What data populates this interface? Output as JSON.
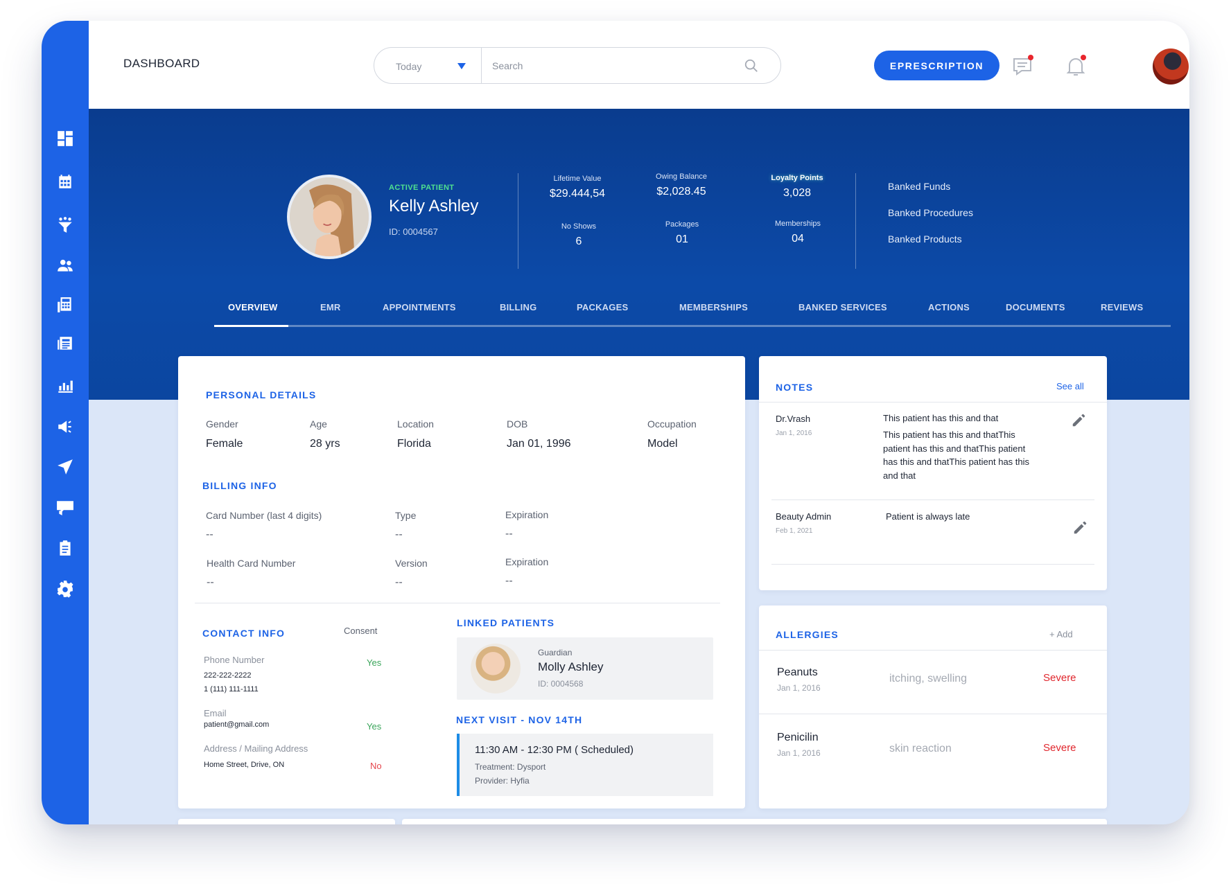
{
  "header": {
    "title": "DASHBOARD",
    "date_filter": "Today",
    "search_placeholder": "Search",
    "cta_label": "EPRESCRIPTION"
  },
  "sidebar": {
    "items": [
      {
        "icon": "dashboard-icon"
      },
      {
        "icon": "calendar-icon"
      },
      {
        "icon": "funnel-icon"
      },
      {
        "icon": "users-icon"
      },
      {
        "icon": "calculator-icon"
      },
      {
        "icon": "newspaper-icon"
      },
      {
        "icon": "bar-chart-icon"
      },
      {
        "icon": "megaphone-icon"
      },
      {
        "icon": "send-icon"
      },
      {
        "icon": "chat-icon"
      },
      {
        "icon": "clipboard-icon"
      },
      {
        "icon": "gear-icon"
      }
    ]
  },
  "patient": {
    "status": "ACTIVE PATIENT",
    "name": "Kelly Ashley",
    "id": "ID: 0004567"
  },
  "stats": {
    "lifetime_label": "Lifetime Value",
    "lifetime_value": "$29.444,54",
    "owing_label": "Owing Balance",
    "owing_value": "$2,028.45",
    "loyalty_label": "Loyalty Points",
    "loyalty_value": "3,028",
    "noshows_label": "No Shows",
    "noshows_value": "6",
    "packages_label": "Packages",
    "packages_value": "01",
    "memberships_label": "Memberships",
    "memberships_value": "04"
  },
  "banked": [
    "Banked Funds",
    "Banked Procedures",
    "Banked Products"
  ],
  "tabs": [
    "OVERVIEW",
    "EMR",
    "APPOINTMENTS",
    "BILLING",
    "PACKAGES",
    "MEMBERSHIPS",
    "BANKED SERVICES",
    "ACTIONS",
    "DOCUMENTS",
    "REVIEWS"
  ],
  "personal": {
    "title": "PERSONAL DETAILS",
    "gender_label": "Gender",
    "gender": "Female",
    "age_label": "Age",
    "age": "28 yrs",
    "location_label": "Location",
    "location": "Florida",
    "dob_label": "DOB",
    "dob": "Jan 01, 1996",
    "occupation_label": "Occupation",
    "occupation": "Model"
  },
  "billing": {
    "title": "BILLING INFO",
    "card_label": "Card Number (last 4 digits)",
    "card": "--",
    "type_label": "Type",
    "type": "--",
    "exp1_label": "Expiration",
    "exp1": "--",
    "health_label": "Health Card Number",
    "health": "--",
    "version_label": "Version",
    "version": "--",
    "exp2_label": "Expiration",
    "exp2": "--"
  },
  "contact": {
    "title": "CONTACT INFO",
    "consent_label": "Consent",
    "phone_label": "Phone Number",
    "phone1": "222-222-2222",
    "phone2": "1 (111) 111-1111",
    "phone_consent": "Yes",
    "email_label": "Email",
    "email": "patient@gmail.com",
    "email_consent": "Yes",
    "address_label": "Address / Mailing Address",
    "address": "Home Street, Drive, ON",
    "address_consent": "No"
  },
  "linked": {
    "title": "LINKED PATIENTS",
    "role": "Guardian",
    "name": "Molly Ashley",
    "id": "ID: 0004568"
  },
  "next_visit": {
    "title": "NEXT VISIT - NOV 14TH",
    "time": "11:30 AM - 12:30 PM ( Scheduled)",
    "treatment": "Treatment: Dysport",
    "provider": "Provider: Hyfia"
  },
  "notes": {
    "title": "NOTES",
    "see_all": "See all",
    "items": [
      {
        "author": "Dr.Vrash",
        "date": "Jan 1, 2016",
        "first_line": "This patient has this and that",
        "text": "This patient has this and thatThis patient has this and thatThis patient has this and thatThis patient has this and that"
      },
      {
        "author": "Beauty Admin",
        "date": "Feb 1, 2021",
        "text": "Patient is always late"
      }
    ]
  },
  "allergies": {
    "title": "ALLERGIES",
    "add_label": "+ Add",
    "items": [
      {
        "name": "Peanuts",
        "date": "Jan 1, 2016",
        "reaction": "itching, swelling",
        "severity": "Severe"
      },
      {
        "name": "Penicilin",
        "date": "Jan 1, 2016",
        "reaction": "skin reaction",
        "severity": "Severe"
      }
    ]
  },
  "colors": {
    "primary": "#1d63e6",
    "hero": "#0c4aa8",
    "active_green": "#4fe08f",
    "severe_red": "#e0262d"
  }
}
